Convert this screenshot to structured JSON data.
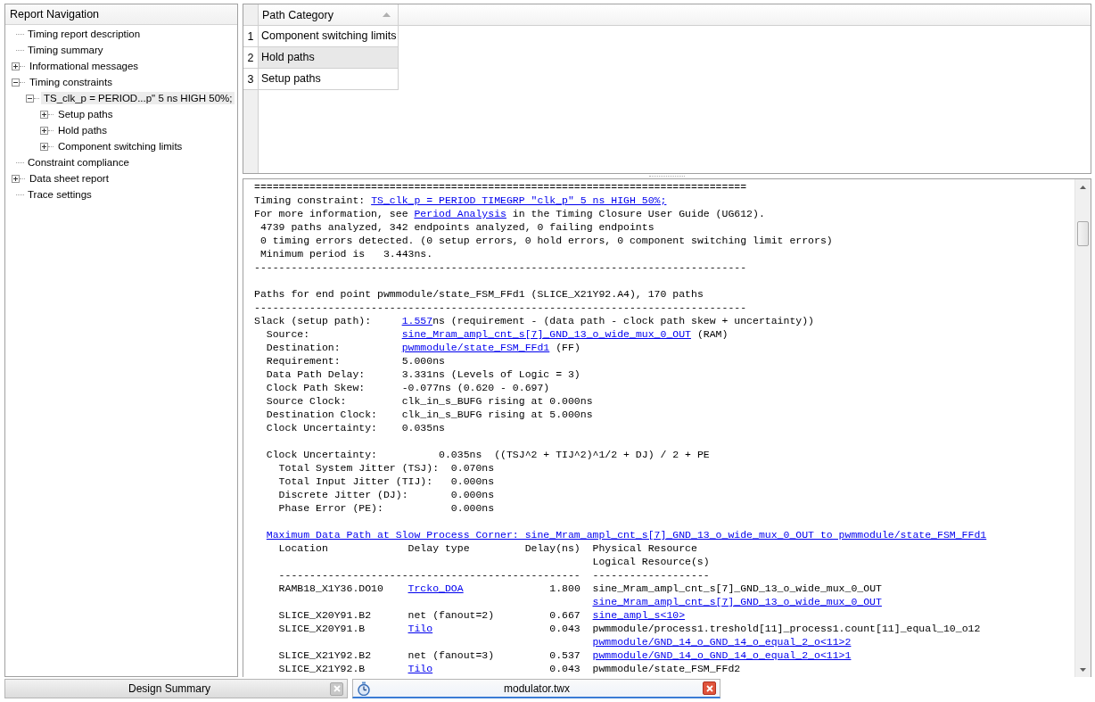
{
  "navigation": {
    "title": "Report Navigation",
    "items": [
      {
        "label": "Timing report description",
        "kind": "leaf",
        "selected": false
      },
      {
        "label": "Timing summary",
        "kind": "leaf",
        "selected": false
      },
      {
        "label": "Informational messages",
        "kind": "branch",
        "expanded": false,
        "selected": false
      },
      {
        "label": "Timing constraints",
        "kind": "branch",
        "expanded": true,
        "selected": false,
        "children": [
          {
            "label": "TS_clk_p = PERIOD...p\" 5 ns HIGH 50%;",
            "kind": "branch",
            "expanded": true,
            "selected": true,
            "children": [
              {
                "label": "Setup paths",
                "kind": "branch",
                "expanded": false,
                "selected": false
              },
              {
                "label": "Hold paths",
                "kind": "branch",
                "expanded": false,
                "selected": false
              },
              {
                "label": "Component switching limits",
                "kind": "branch",
                "expanded": false,
                "selected": false
              }
            ]
          }
        ]
      },
      {
        "label": "Constraint compliance",
        "kind": "leaf",
        "selected": false
      },
      {
        "label": "Data sheet report",
        "kind": "branch",
        "expanded": false,
        "selected": false
      },
      {
        "label": "Trace settings",
        "kind": "leaf",
        "selected": false
      }
    ]
  },
  "path_table": {
    "column": "Path Category",
    "rows": [
      {
        "number": "1",
        "label": "Component switching limits",
        "selected": false
      },
      {
        "number": "2",
        "label": "Hold paths",
        "selected": true
      },
      {
        "number": "3",
        "label": "Setup paths",
        "selected": false
      }
    ]
  },
  "report": {
    "lines": [
      {
        "kind": "text",
        "segments": [
          {
            "text": "================================================================================",
            "link": false
          }
        ]
      },
      {
        "kind": "text",
        "segments": [
          {
            "text": "Timing constraint: ",
            "link": false
          },
          {
            "text": "TS_clk_p = PERIOD TIMEGRP \"clk_p\" 5 ns HIGH 50%;",
            "link": true
          }
        ]
      },
      {
        "kind": "text",
        "segments": [
          {
            "text": "For more information, see ",
            "link": false
          },
          {
            "text": "Period Analysis",
            "link": true
          },
          {
            "text": " in the Timing Closure User Guide (UG612).",
            "link": false
          }
        ]
      },
      {
        "kind": "text",
        "segments": [
          {
            "text": " 4739 paths analyzed, 342 endpoints analyzed, 0 failing endpoints",
            "link": false
          }
        ]
      },
      {
        "kind": "text",
        "segments": [
          {
            "text": " 0 timing errors detected. (0 setup errors, 0 hold errors, 0 component switching limit errors)",
            "link": false
          }
        ]
      },
      {
        "kind": "text",
        "segments": [
          {
            "text": " Minimum period is   3.443ns.",
            "link": false
          }
        ]
      },
      {
        "kind": "text",
        "segments": [
          {
            "text": "--------------------------------------------------------------------------------",
            "link": false
          }
        ]
      },
      {
        "kind": "text",
        "space_before": true,
        "segments": [
          {
            "text": "Paths for end point pwmmodule/state_FSM_FFd1 (SLICE_X21Y92.A4), 170 paths",
            "link": false
          }
        ]
      },
      {
        "kind": "text",
        "segments": [
          {
            "text": "--------------------------------------------------------------------------------",
            "link": false
          }
        ]
      },
      {
        "kind": "text",
        "segments": [
          {
            "text": "Slack (setup path):     ",
            "link": false
          },
          {
            "text": "1.557",
            "link": true
          },
          {
            "text": "ns (requirement - (data path - clock path skew + uncertainty))",
            "link": false
          }
        ]
      },
      {
        "kind": "text",
        "segments": [
          {
            "text": "  Source:               ",
            "link": false
          },
          {
            "text": "sine_Mram_ampl_cnt_s[7]_GND_13_o_wide_mux_0_OUT",
            "link": true
          },
          {
            "text": " (RAM)",
            "link": false
          }
        ]
      },
      {
        "kind": "text",
        "segments": [
          {
            "text": "  Destination:          ",
            "link": false
          },
          {
            "text": "pwmmodule/state_FSM_FFd1",
            "link": true
          },
          {
            "text": " (FF)",
            "link": false
          }
        ]
      },
      {
        "kind": "text",
        "segments": [
          {
            "text": "  Requirement:          5.000ns",
            "link": false
          }
        ]
      },
      {
        "kind": "text",
        "segments": [
          {
            "text": "  Data Path Delay:      3.331ns (Levels of Logic = 3)",
            "link": false
          }
        ]
      },
      {
        "kind": "text",
        "segments": [
          {
            "text": "  Clock Path Skew:      -0.077ns (0.620 - 0.697)",
            "link": false
          }
        ]
      },
      {
        "kind": "text",
        "segments": [
          {
            "text": "  Source Clock:         clk_in_s_BUFG rising at 0.000ns",
            "link": false
          }
        ]
      },
      {
        "kind": "text",
        "segments": [
          {
            "text": "  Destination Clock:    clk_in_s_BUFG rising at 5.000ns",
            "link": false
          }
        ]
      },
      {
        "kind": "text",
        "segments": [
          {
            "text": "  Clock Uncertainty:    0.035ns",
            "link": false
          }
        ]
      },
      {
        "kind": "text",
        "space_before": true,
        "segments": [
          {
            "text": "  Clock Uncertainty:          0.035ns  ((TSJ^2 + TIJ^2)^1/2 + DJ) / 2 + PE",
            "link": false
          }
        ]
      },
      {
        "kind": "text",
        "segments": [
          {
            "text": "    Total System Jitter (TSJ):  0.070ns",
            "link": false
          }
        ]
      },
      {
        "kind": "text",
        "segments": [
          {
            "text": "    Total Input Jitter (TIJ):   0.000ns",
            "link": false
          }
        ]
      },
      {
        "kind": "text",
        "segments": [
          {
            "text": "    Discrete Jitter (DJ):       0.000ns",
            "link": false
          }
        ]
      },
      {
        "kind": "text",
        "segments": [
          {
            "text": "    Phase Error (PE):           0.000ns",
            "link": false
          }
        ]
      },
      {
        "kind": "indent",
        "space_before": true,
        "segments": [
          {
            "text": "Maximum Data Path at Slow Process Corner: sine_Mram_ampl_cnt_s[7]_GND_13_o_wide_mux_0_OUT to pwmmodule/state_FSM_FFd1",
            "link": true
          }
        ]
      },
      {
        "kind": "text",
        "segments": [
          {
            "text": "    Location             Delay type         Delay(ns)  Physical Resource",
            "link": false
          }
        ]
      },
      {
        "kind": "column",
        "segments": [
          {
            "text": "Logical Resource(s)",
            "link": false
          }
        ]
      },
      {
        "kind": "text",
        "segments": [
          {
            "text": "    -------------------------------------------------  -------------------",
            "link": false
          }
        ]
      },
      {
        "kind": "text",
        "segments": [
          {
            "text": "    RAMB18_X1Y36.DO10    ",
            "link": false
          },
          {
            "text": "Trcko_DOA",
            "link": true
          },
          {
            "text": "              1.800  sine_Mram_ampl_cnt_s[7]_GND_13_o_wide_mux_0_OUT",
            "link": false
          }
        ]
      },
      {
        "kind": "column",
        "segments": [
          {
            "text": "sine_Mram_ampl_cnt_s[7]_GND_13_o_wide_mux_0_OUT",
            "link": true
          }
        ]
      },
      {
        "kind": "text",
        "segments": [
          {
            "text": "    SLICE_X20Y91.B2      net (fanout=2)         0.667  ",
            "link": false
          },
          {
            "text": "sine_ampl_s<10>",
            "link": true
          }
        ]
      },
      {
        "kind": "text",
        "segments": [
          {
            "text": "    SLICE_X20Y91.B       ",
            "link": false
          },
          {
            "text": "Tilo",
            "link": true
          },
          {
            "text": "                   0.043  pwmmodule/process1.treshold[11]_process1.count[11]_equal_10_o12",
            "link": false
          }
        ]
      },
      {
        "kind": "column",
        "segments": [
          {
            "text": "pwmmodule/GND_14_o_GND_14_o_equal_2_o<11>2",
            "link": true
          }
        ]
      },
      {
        "kind": "text",
        "segments": [
          {
            "text": "    SLICE_X21Y92.B2      net (fanout=3)         0.537  ",
            "link": false
          },
          {
            "text": "pwmmodule/GND_14_o_GND_14_o_equal_2_o<11>1",
            "link": true
          }
        ]
      },
      {
        "kind": "text",
        "segments": [
          {
            "text": "    SLICE_X21Y92.B       ",
            "link": false
          },
          {
            "text": "Tilo",
            "link": true
          },
          {
            "text": "                   0.043  pwmmodule/state_FSM_FFd2",
            "link": false
          }
        ]
      }
    ]
  },
  "document_tabs": [
    {
      "label": "Design Summary",
      "selected": false
    },
    {
      "label": "modulator.twx",
      "selected": true
    }
  ]
}
